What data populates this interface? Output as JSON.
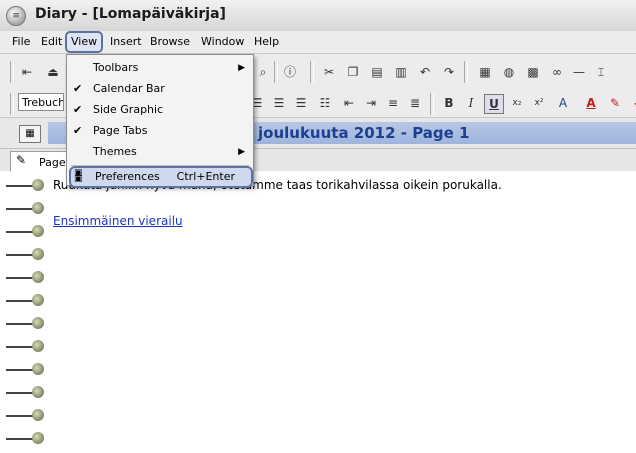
{
  "window": {
    "title": "Diary - [Lomapäiväkirja]"
  },
  "menubar": [
    {
      "label": "File"
    },
    {
      "label": "Edit"
    },
    {
      "label": "View",
      "active": true
    },
    {
      "label": "Insert"
    },
    {
      "label": "Browse"
    },
    {
      "label": "Window"
    },
    {
      "label": "Help"
    }
  ],
  "view_menu": {
    "items": [
      {
        "label": "Toolbars",
        "checked": false,
        "submenu": true
      },
      {
        "label": "Calendar Bar",
        "checked": true
      },
      {
        "label": "Side Graphic",
        "checked": true
      },
      {
        "label": "Page Tabs",
        "checked": true
      },
      {
        "label": "Themes",
        "checked": false,
        "submenu": true
      }
    ],
    "preferences": {
      "label": "Preferences",
      "shortcut": "Ctrl+Enter",
      "highlighted": true
    },
    "check_glyph": "✔",
    "arrow_glyph": "▶"
  },
  "format_toolbar": {
    "font_value": "Trebuche"
  },
  "date_bar": {
    "text": "joulukuuta 2012 - Page 1"
  },
  "tabs": [
    {
      "label": "Page"
    }
  ],
  "page": {
    "body_text": "Ruukuta juhliin hyvä mana, otetämme taas torikahvilassa oikein porukalla.",
    "link_text": "Ensimmäinen vierailu"
  },
  "colors": {
    "date_text": "#1c3f8f",
    "link": "#1b34c6",
    "menu_highlight": "#5a73a5"
  }
}
